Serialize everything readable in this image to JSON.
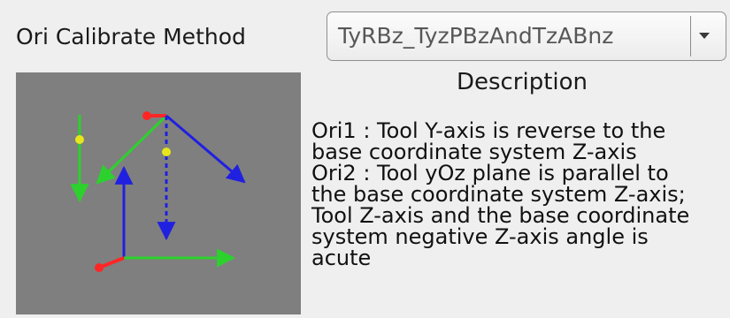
{
  "calibration": {
    "method_label": "Ori Calibrate Method",
    "method_value": "TyRBz_TyzPBzAndTzABnz"
  },
  "description": {
    "title": "Description",
    "lines": [
      "Ori1 : Tool Y-axis is reverse to the",
      "base coordinate system Z-axis",
      "Ori2 : Tool yOz plane is parallel to",
      "the base coordinate system Z-axis;",
      "Tool Z-axis and the base coordinate",
      "system negative Z-axis angle is",
      "acute"
    ]
  },
  "colors": {
    "x_axis": "#ff2626",
    "y_axis": "#2dd12d",
    "z_axis": "#2020e0",
    "marker": "#e6e61a",
    "diagram_background": "#7f7f7f"
  },
  "icons": {
    "dropdown": "chevron-down-icon"
  }
}
